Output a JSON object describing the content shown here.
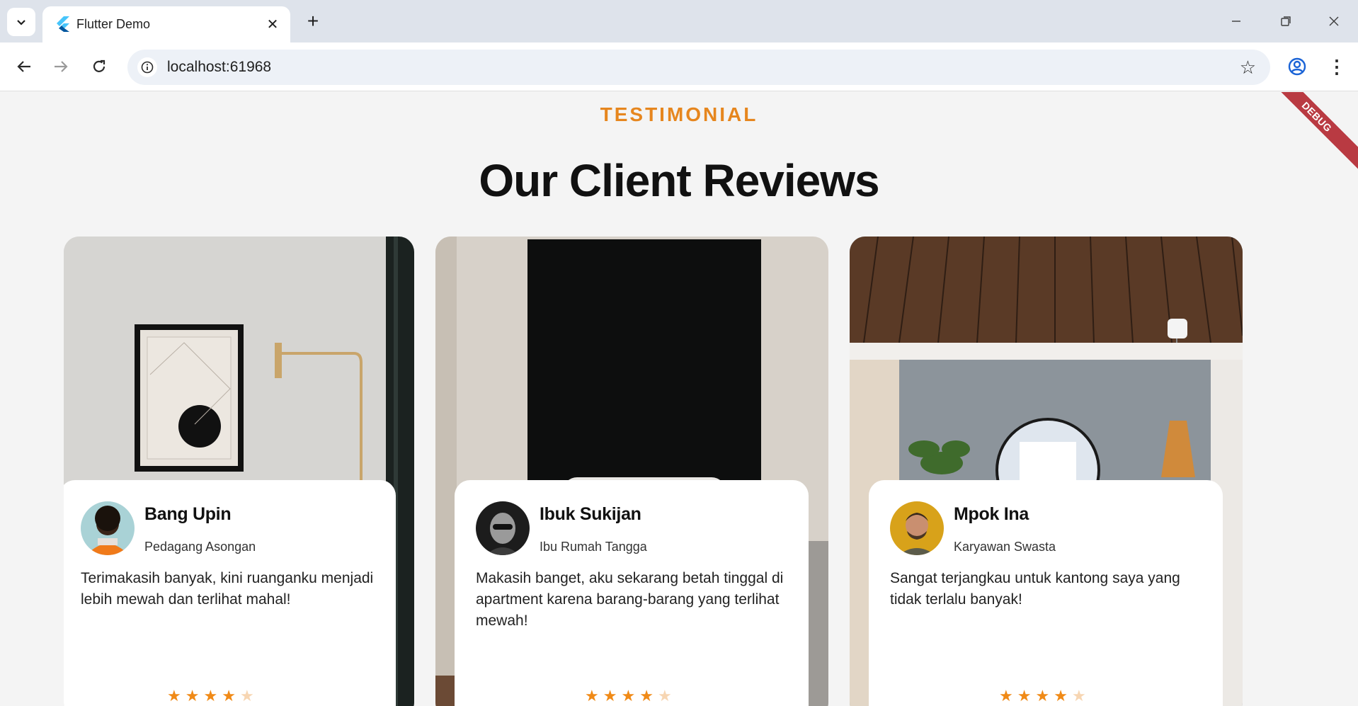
{
  "browser": {
    "tab_title": "Flutter Demo",
    "url": "localhost:61968"
  },
  "page": {
    "eyebrow": "TESTIMONIAL",
    "heading": "Our Client Reviews",
    "debug_label": "DEBUG"
  },
  "reviews": [
    {
      "name": "Bang Upin",
      "role": "Pedagang Asongan",
      "quote": "Terimakasih banyak, kini ruanganku menjadi lebih mewah dan terlihat mahal!",
      "rating": 4,
      "rating_max": 5
    },
    {
      "name": "Ibuk Sukijan",
      "role": "Ibu Rumah Tangga",
      "quote": "Makasih banget, aku sekarang betah tinggal di apartment karena barang-barang yang terlihat mewah!",
      "rating": 4,
      "rating_max": 5
    },
    {
      "name": "Mpok Ina",
      "role": "Karyawan Swasta",
      "quote": "Sangat terjangkau untuk kantong saya yang tidak terlalu banyak!",
      "rating": 4,
      "rating_max": 5
    }
  ],
  "colors": {
    "accent": "#e6861e",
    "star": "#f08a17",
    "star_empty": "#f7d6b3",
    "debug_ribbon": "#b93a42"
  }
}
